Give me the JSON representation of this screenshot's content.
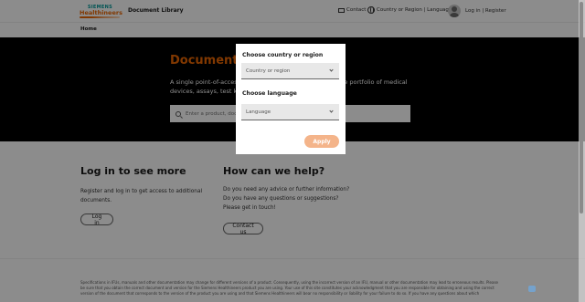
{
  "header": {
    "logo_brand": "SIEMENS",
    "logo_sub": "Healthineers",
    "site_title": "Document Library",
    "contact_label": "Contact",
    "country_language_label": "Country or Region | Language",
    "login_label": "Log in | Register"
  },
  "breadcrumb": {
    "home": "Home"
  },
  "hero": {
    "title": "Document Library",
    "description": "A single point-of-access for the documentation of our entire portfolio of medical devices, assays, test kits and services.",
    "search_placeholder": "Enter a product, document number, or keyword"
  },
  "login_section": {
    "title": "Log in to see more",
    "description": "Register and log in to get access to additional documents.",
    "button": "Log in"
  },
  "help_section": {
    "title": "How can we help?",
    "line1": "Do you need any advice or further information?",
    "line2": "Do you have any questions or suggestions?",
    "line3": "Please get in touch!",
    "button": "Contact us"
  },
  "disclaimer": "Specifications in IFUs, manuals and other documentation may change for different versions of a product. Consequently, using the incorrect version of an IFU, manual or other documentation may lead to erroneous results. Please be sure that you obtain the correct document and version for the Siemens Healthineers product you are using. Your use of this site constitutes your acknowledgment that you are responsible for obtaining and using the correct version of the document that corresponds to the version of the product you are using and that Siemens Healthineers will bear no responsibility or liability for your failure to do so. If you have any questions about which",
  "modal": {
    "country_label": "Choose country or region",
    "country_placeholder": "Country or region",
    "language_label": "Choose language",
    "language_placeholder": "Language",
    "apply_button": "Apply"
  },
  "colors": {
    "accent": "#ec6602",
    "apply_disabled": "#f4b48a",
    "brand_teal": "#009999"
  }
}
